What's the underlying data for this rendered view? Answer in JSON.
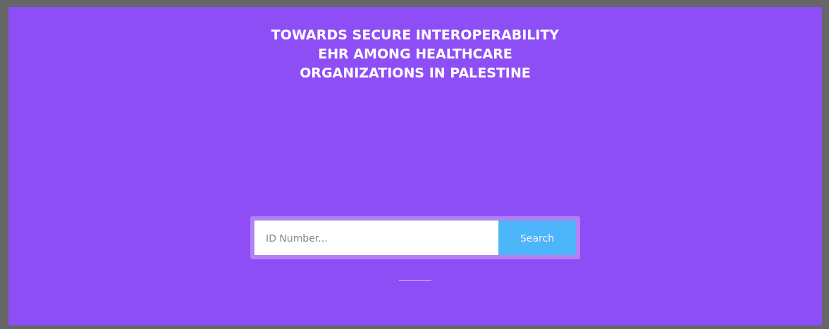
{
  "title_lines": [
    "TOWARDS SECURE INTEROPERABILITY",
    "EHR AMONG HEALTHCARE",
    "ORGANIZATIONS IN PALESTINE"
  ],
  "search": {
    "placeholder": "ID Number...",
    "button": "Search"
  }
}
